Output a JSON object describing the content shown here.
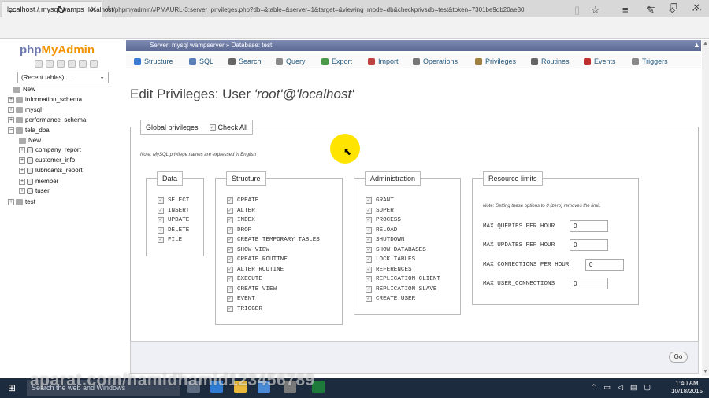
{
  "browser": {
    "tab_title": "localhost / mysql wamps",
    "new_tab": "+",
    "url_host": "localhost",
    "url_path": "/phpmyadmin/#PMAURL-3:server_privileges.php?db=&table=&server=1&target=&viewing_mode=db&checkprivsdb=test&token=7301be9db20ae30"
  },
  "sidebar": {
    "logo_php": "php",
    "logo_myadmin": "MyAdmin",
    "db_select": "(Recent tables) ...",
    "tree": [
      {
        "label": "New",
        "level": 1,
        "type": "new"
      },
      {
        "label": "information_schema",
        "level": 0,
        "type": "db"
      },
      {
        "label": "mysql",
        "level": 0,
        "type": "db"
      },
      {
        "label": "performance_schema",
        "level": 0,
        "type": "db"
      },
      {
        "label": "tela_dba",
        "level": 0,
        "type": "db-open"
      },
      {
        "label": "New",
        "level": 2,
        "type": "new"
      },
      {
        "label": "company_report",
        "level": 2,
        "type": "table"
      },
      {
        "label": "customer_info",
        "level": 2,
        "type": "table"
      },
      {
        "label": "lubricants_report",
        "level": 2,
        "type": "table"
      },
      {
        "label": "member",
        "level": 2,
        "type": "table"
      },
      {
        "label": "tuser",
        "level": 2,
        "type": "table"
      },
      {
        "label": "test",
        "level": 0,
        "type": "db"
      }
    ]
  },
  "breadcrumb": {
    "server": "Server: mysql wampserver",
    "separator": "»",
    "database": "Database: test"
  },
  "tabs": [
    {
      "label": "Structure",
      "icon": "structure-icon",
      "color": "#3a7bd5"
    },
    {
      "label": "SQL",
      "icon": "sql-icon",
      "color": "#5a7fb8"
    },
    {
      "label": "Search",
      "icon": "search-icon",
      "color": "#666666"
    },
    {
      "label": "Query",
      "icon": "query-icon",
      "color": "#8a8a8a"
    },
    {
      "label": "Export",
      "icon": "export-icon",
      "color": "#4a9a4a"
    },
    {
      "label": "Import",
      "icon": "import-icon",
      "color": "#c04040"
    },
    {
      "label": "Operations",
      "icon": "operations-icon",
      "color": "#777777"
    },
    {
      "label": "Privileges",
      "icon": "privileges-icon",
      "color": "#a08040"
    },
    {
      "label": "Routines",
      "icon": "routines-icon",
      "color": "#666666"
    },
    {
      "label": "Events",
      "icon": "events-icon",
      "color": "#c03030"
    },
    {
      "label": "Triggers",
      "icon": "triggers-icon",
      "color": "#888888"
    }
  ],
  "main": {
    "heading_prefix": "Edit Privileges: User ",
    "heading_user": "'root'@'localhost'",
    "global_privileges": "Global privileges",
    "check_all": "Check All",
    "note": "Note: MySQL privilege names are expressed in English",
    "data_legend": "Data",
    "data_privs": [
      "SELECT",
      "INSERT",
      "UPDATE",
      "DELETE",
      "FILE"
    ],
    "structure_legend": "Structure",
    "structure_privs": [
      "CREATE",
      "ALTER",
      "INDEX",
      "DROP",
      "CREATE TEMPORARY TABLES",
      "SHOW VIEW",
      "CREATE ROUTINE",
      "ALTER ROUTINE",
      "EXECUTE",
      "CREATE VIEW",
      "EVENT",
      "TRIGGER"
    ],
    "admin_legend": "Administration",
    "admin_privs": [
      "GRANT",
      "SUPER",
      "PROCESS",
      "RELOAD",
      "SHUTDOWN",
      "SHOW DATABASES",
      "LOCK TABLES",
      "REFERENCES",
      "REPLICATION CLIENT",
      "REPLICATION SLAVE",
      "CREATE USER"
    ],
    "resource_legend": "Resource limits",
    "resource_note": "Note: Setting these options to 0 (zero) removes the limit.",
    "resources": [
      {
        "label": "MAX QUERIES PER HOUR",
        "value": "0"
      },
      {
        "label": "MAX UPDATES PER HOUR",
        "value": "0"
      },
      {
        "label": "MAX CONNECTIONS PER HOUR",
        "value": "0"
      },
      {
        "label": "MAX USER_CONNECTIONS",
        "value": "0"
      }
    ],
    "go_button": "Go"
  },
  "taskbar": {
    "search_placeholder": "Search the web and Windows",
    "time": "1:40 AM",
    "date": "10/18/2015",
    "watermark": "aparat.com/hamidhamid123456789"
  },
  "colors": {
    "breadcrumb_bg": "#6b78a3",
    "cursor_highlight": "#ffe400",
    "logo_blue": "#6c78af",
    "logo_orange": "#f29400",
    "taskbar_bg": "#1d2b3e"
  }
}
